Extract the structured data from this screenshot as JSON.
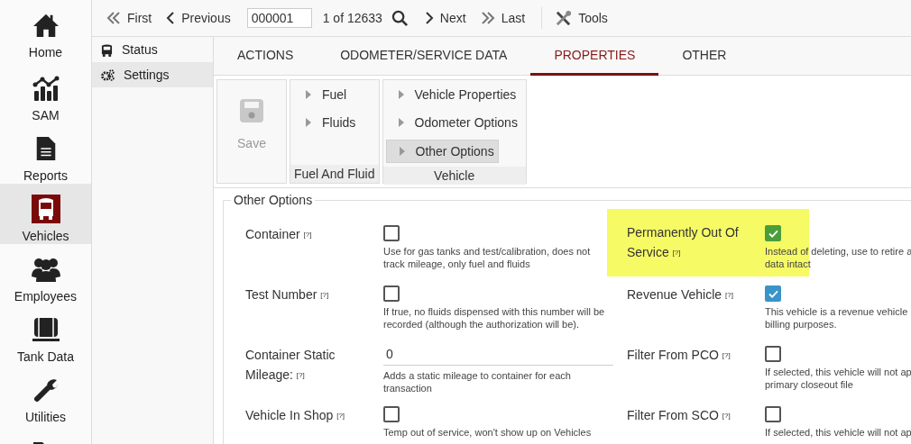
{
  "nav": [
    {
      "label": "Home",
      "selected": false
    },
    {
      "label": "SAM",
      "selected": false
    },
    {
      "label": "Reports",
      "selected": false
    },
    {
      "label": "Vehicles",
      "selected": true
    },
    {
      "label": "Employees",
      "selected": false
    },
    {
      "label": "Tank Data",
      "selected": false
    },
    {
      "label": "Utilities",
      "selected": false
    },
    {
      "selected": false
    }
  ],
  "toolbar": {
    "first": "First",
    "previous": "Previous",
    "record": "000001",
    "count": "1 of 12633",
    "next": "Next",
    "last": "Last",
    "tools": "Tools"
  },
  "subnav": [
    {
      "label": "Status",
      "selected": false
    },
    {
      "label": "Settings",
      "selected": true
    }
  ],
  "tabs": [
    {
      "label": "ACTIONS",
      "selected": false
    },
    {
      "label": "ODOMETER/SERVICE DATA",
      "selected": false
    },
    {
      "label": "PROPERTIES",
      "selected": true
    },
    {
      "label": "OTHER",
      "selected": false
    }
  ],
  "ribbon": {
    "save": {
      "label": "Save",
      "disabled": true
    },
    "groups": [
      {
        "title": "Fuel And Fluid",
        "items": [
          {
            "label": "Fuel",
            "selected": false
          },
          {
            "label": "Fluids",
            "selected": false
          }
        ]
      },
      {
        "title": "Vehicle",
        "items": [
          {
            "label": "Vehicle Properties",
            "selected": false
          },
          {
            "label": "Odometer Options",
            "selected": false
          },
          {
            "label": "Other Options",
            "selected": true
          }
        ]
      }
    ]
  },
  "section": {
    "title": "Other Options",
    "fields": [
      {
        "kind": "checkbox",
        "label": "Container",
        "help": "[?]",
        "checked": false,
        "highlighted": false,
        "description": "Use for gas tanks and test/calibration, does not track mileage, only fuel and fluids"
      },
      {
        "kind": "checkbox",
        "label": "Permanently Out Of Service",
        "help": "[?]",
        "checked": true,
        "highlighted": true,
        "description": "Instead of deleting, use to retire a",
        "description_2": "data intact"
      },
      {
        "kind": "checkbox",
        "label": "Test Number",
        "help": "[?]",
        "checked": false,
        "highlighted": false,
        "description": "If true, no fluids dispensed with this number will be recorded (although the authorization will be)."
      },
      {
        "kind": "checkbox",
        "label": "Revenue Vehicle",
        "help": "[?]",
        "checked": true,
        "highlighted": false,
        "description": "This vehicle is a revenue vehicle",
        "description_2": "billing purposes."
      },
      {
        "kind": "number",
        "label": "Container Static Mileage:",
        "help": "[?]",
        "value": "0",
        "highlighted": false,
        "description": "Adds a static mileage to container for each transaction"
      },
      {
        "kind": "checkbox",
        "label": "Filter From PCO",
        "help": "[?]",
        "checked": false,
        "highlighted": false,
        "description": "If selected, this vehicle will not ap",
        "description_2": "primary closeout file"
      },
      {
        "kind": "checkbox",
        "label": "Vehicle In Shop",
        "help": "[?]",
        "checked": false,
        "highlighted": false,
        "description": "Temp out of service, won't show up on Vehicles"
      },
      {
        "kind": "checkbox",
        "label": "Filter From SCO",
        "help": "[?]",
        "checked": false,
        "highlighted": false,
        "description": "If selected, this vehicle will not ap"
      }
    ]
  }
}
